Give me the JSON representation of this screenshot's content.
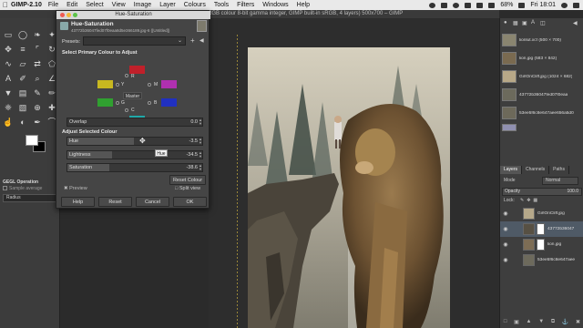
{
  "menubar": {
    "app": "GIMP-2.10",
    "items": [
      "File",
      "Edit",
      "Select",
      "View",
      "Image",
      "Layer",
      "Colours",
      "Tools",
      "Filters",
      "Windows",
      "Help"
    ],
    "battery": "68%",
    "clock": "Fri 18:01"
  },
  "window_title": "RGB colour 8-bit gamma integer, GIMP built-in sRGB, 4 layers) 500x700 – GIMP",
  "toolbox": {
    "tool_icons": [
      "rect-select-icon",
      "ellipse-select-icon",
      "lasso-icon",
      "fuzzy-select-icon",
      "move-icon",
      "align-icon",
      "crop-icon",
      "rotate-icon",
      "warp-icon",
      "perspective-icon",
      "flip-icon",
      "cage-icon",
      "text-icon",
      "color-picker-icon",
      "zoom-icon",
      "measure-icon",
      "bucket-fill-icon",
      "gradient-icon",
      "paintbrush-icon",
      "pencil-icon",
      "airbrush-icon",
      "eraser-icon",
      "clone-icon",
      "heal-icon",
      "smudge-icon",
      "dodge-icon",
      "ink-icon",
      "paths-icon"
    ],
    "foreground_color": "#ffffff",
    "background_color": "#000000",
    "options_title": "GEGL Operation",
    "sample_average": "Sample average",
    "radius_label": "Radius"
  },
  "dialog": {
    "window_title": "Hue-Saturation",
    "heading": "Hue-Saturation",
    "subtitle": "43772b36047fed07f0eaa8d5e366189.jpg-6 ([Untitled])",
    "presets_label": "Presets:",
    "section_primary": "Select Primary Colour to Adjust",
    "primaries": [
      {
        "key": "R",
        "color": "#c0202a"
      },
      {
        "key": "Y",
        "color": "#c8b820"
      },
      {
        "key": "M",
        "color": "#b030b0"
      },
      {
        "key": "G",
        "color": "#30a030"
      },
      {
        "key": "B",
        "color": "#2030c0"
      },
      {
        "key": "C",
        "color": "#20a8a8"
      }
    ],
    "master_label": "Master",
    "overlap": {
      "label": "Overlap",
      "value": "0.0",
      "fraction": 0.0
    },
    "section_adjust": "Adjust Selected Colour",
    "hue": {
      "label": "Hue",
      "value": "-3.5",
      "fraction": 0.49
    },
    "lightness": {
      "label": "Lightness",
      "value": "-34.5",
      "fraction": 0.33
    },
    "saturation": {
      "label": "Saturation",
      "value": "-38.6",
      "fraction": 0.31
    },
    "tooltip": "Hue",
    "reset_colour": "Reset Colour",
    "preview_label": "Preview",
    "split_view_label": "Split view",
    "buttons": {
      "help": "Help",
      "reset": "Reset",
      "cancel": "Cancel",
      "ok": "OK"
    }
  },
  "dock": {
    "images": [
      {
        "name": "lionlut.xcf (500 × 700)",
        "color": "#8a8570"
      },
      {
        "name": "lion.jpg (583 × 842)",
        "color": "#7a6a50"
      },
      {
        "name": "GirlOnCliff.jpg (1024 × 682)",
        "color": "#b8a888"
      },
      {
        "name": "43772b36047fed07f0eaa",
        "color": "#6c6a5c"
      },
      {
        "name": "53ee5f6c8e647aee656a5d0",
        "color": "#6d695a"
      },
      {
        "name": "",
        "color": "#9090b0"
      }
    ],
    "tabs": [
      "Layers",
      "Channels",
      "Paths"
    ],
    "mode_label": "Mode",
    "mode_value": "Normal",
    "opacity_label": "Opacity",
    "opacity_value": "100.0",
    "lock_label": "Lock:",
    "layers": [
      {
        "name": "GirlOnCliff.jpg",
        "thumb": "#b5a88a",
        "mask": "",
        "selected": false
      },
      {
        "name": "43772b36047",
        "thumb": "#575043",
        "mask": "#ffffff",
        "selected": true
      },
      {
        "name": "lion.jpg",
        "thumb": "#7d6d55",
        "mask": "#ffffff",
        "selected": false
      },
      {
        "name": "53ee5f6c8e647aee",
        "thumb": "#6d6a5c",
        "mask": "",
        "selected": false
      }
    ]
  }
}
